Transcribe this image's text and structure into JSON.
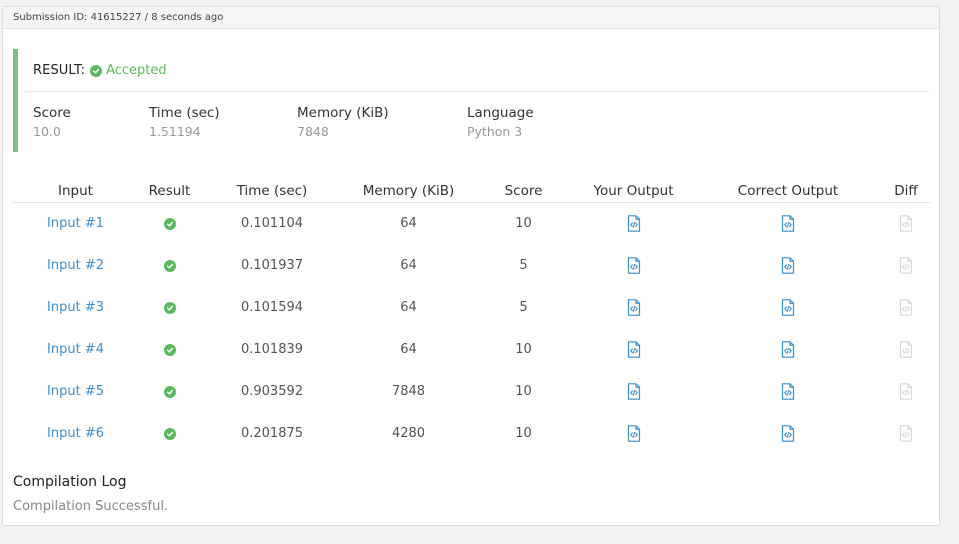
{
  "header": {
    "submission_text": "Submission ID: 41615227 / 8 seconds ago"
  },
  "result": {
    "label": "RESULT:",
    "status": "Accepted",
    "status_icon": "check-circle-icon",
    "status_color": "#5cb85c"
  },
  "stats": {
    "score": {
      "label": "Score",
      "value": "10.0"
    },
    "time": {
      "label": "Time (sec)",
      "value": "1.51194"
    },
    "memory": {
      "label": "Memory (KiB)",
      "value": "7848"
    },
    "language": {
      "label": "Language",
      "value": "Python 3"
    }
  },
  "table": {
    "columns": [
      "Input",
      "Result",
      "Time (sec)",
      "Memory (KiB)",
      "Score",
      "Your Output",
      "Correct Output",
      "Diff"
    ],
    "rows": [
      {
        "input": "Input #1",
        "time": "0.101104",
        "memory": "64",
        "score": "10"
      },
      {
        "input": "Input #2",
        "time": "0.101937",
        "memory": "64",
        "score": "5"
      },
      {
        "input": "Input #3",
        "time": "0.101594",
        "memory": "64",
        "score": "5"
      },
      {
        "input": "Input #4",
        "time": "0.101839",
        "memory": "64",
        "score": "10"
      },
      {
        "input": "Input #5",
        "time": "0.903592",
        "memory": "7848",
        "score": "10"
      },
      {
        "input": "Input #6",
        "time": "0.201875",
        "memory": "4280",
        "score": "10"
      }
    ]
  },
  "compilation": {
    "title": "Compilation Log",
    "message": "Compilation Successful."
  },
  "colors": {
    "accent_blue": "#3a8fd1",
    "success_green": "#5cb85c",
    "result_border": "#7cc383",
    "disabled_icon": "#d8d8d8"
  }
}
